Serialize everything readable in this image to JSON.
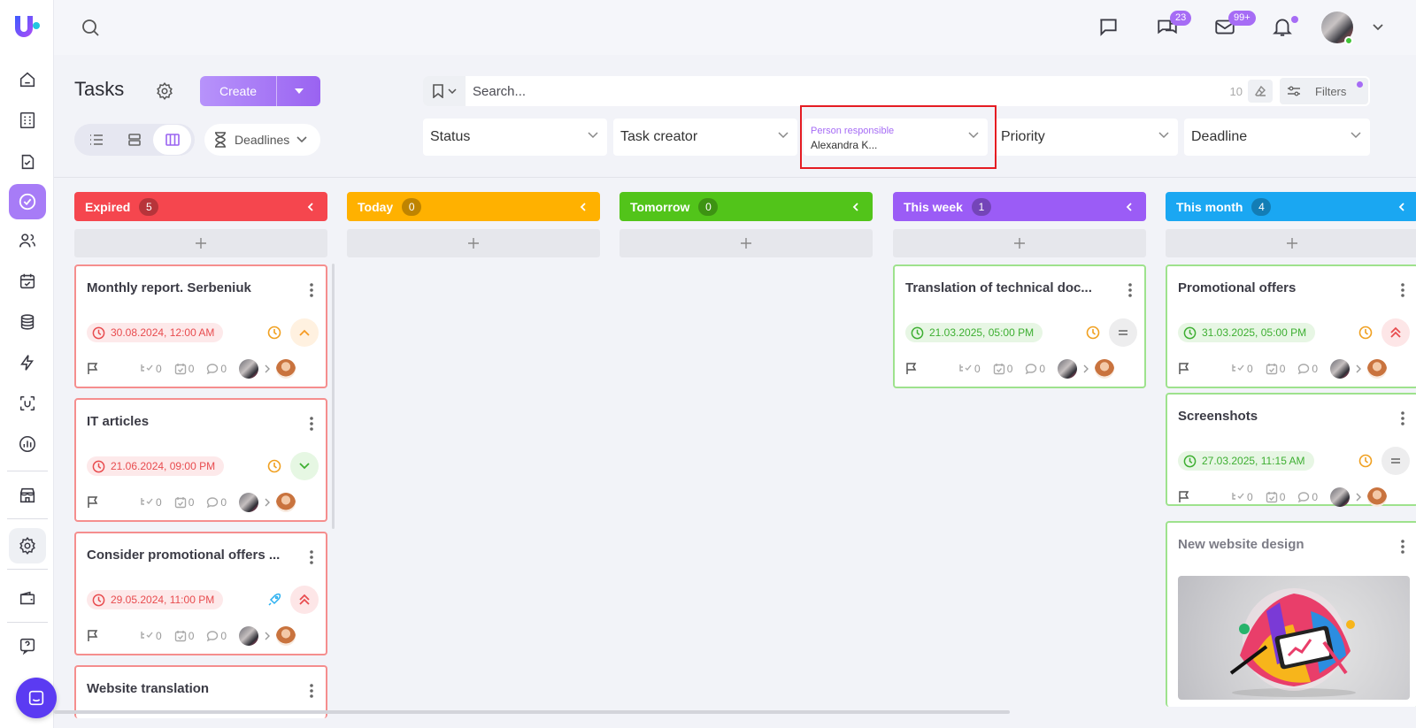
{
  "header": {
    "title": "Tasks",
    "create_label": "Create",
    "deadlines_label": "Deadlines",
    "messages_badge": "23",
    "mail_badge": "99+"
  },
  "search": {
    "placeholder": "Search...",
    "count": "10",
    "filters_label": "Filters"
  },
  "filters": {
    "status": "Status",
    "task_creator": "Task creator",
    "person_responsible_label": "Person responsible",
    "person_responsible_value": "Alexandra K...",
    "priority": "Priority",
    "deadline": "Deadline"
  },
  "colors": {
    "accent": "#a66cf5",
    "expired": "#f5464e",
    "today": "#ffb100",
    "tomorrow": "#52c41a",
    "this_week": "#9b5cf6",
    "this_month": "#1aa7f2"
  },
  "columns": [
    {
      "name": "Expired",
      "count": "5",
      "cards": [
        {
          "title": "Monthly report. Serbeniuk",
          "date": "30.08.2024, 12:00 AM",
          "priority": "high",
          "subtasks": "0",
          "checklist": "0",
          "comments": "0"
        },
        {
          "title": "IT articles",
          "date": "21.06.2024, 09:00 PM",
          "priority": "low",
          "subtasks": "0",
          "checklist": "0",
          "comments": "0"
        },
        {
          "title": "Consider promotional offers ...",
          "date": "29.05.2024, 11:00 PM",
          "priority": "highest",
          "subtasks": "0",
          "checklist": "0",
          "comments": "0"
        },
        {
          "title": "Website translation"
        }
      ]
    },
    {
      "name": "Today",
      "count": "0",
      "cards": []
    },
    {
      "name": "Tomorrow",
      "count": "0",
      "cards": []
    },
    {
      "name": "This week",
      "count": "1",
      "cards": [
        {
          "title": "Translation of technical doc...",
          "date": "21.03.2025, 05:00 PM",
          "priority": "medium",
          "subtasks": "0",
          "checklist": "0",
          "comments": "0"
        }
      ]
    },
    {
      "name": "This month",
      "count": "4",
      "cards": [
        {
          "title": "Promotional offers",
          "date": "31.03.2025, 05:00 PM",
          "priority": "highest",
          "subtasks": "0",
          "checklist": "0",
          "comments": "0"
        },
        {
          "title": "Screenshots",
          "date": "27.03.2025, 11:15 AM",
          "priority": "medium",
          "subtasks": "0",
          "checklist": "0",
          "comments": "0"
        },
        {
          "title": "New website design"
        }
      ]
    }
  ]
}
